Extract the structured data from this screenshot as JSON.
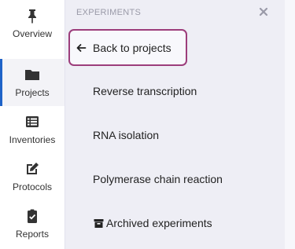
{
  "nav": {
    "items": [
      {
        "label": "Overview",
        "icon": "pin-icon"
      },
      {
        "label": "Projects",
        "icon": "folder-icon"
      },
      {
        "label": "Inventories",
        "icon": "list-icon"
      },
      {
        "label": "Protocols",
        "icon": "edit-icon"
      },
      {
        "label": "Reports",
        "icon": "clipboard-check-icon"
      }
    ],
    "active": "Projects",
    "accent_color": "#1f63c8"
  },
  "panel": {
    "header": "EXPERIMENTS",
    "back_label": "Back to projects",
    "experiments": [
      "Reverse transcription",
      "RNA isolation",
      "Polymerase chain reaction"
    ],
    "archived_label": "Archived experiments",
    "focus_color": "#9c3d7b"
  }
}
